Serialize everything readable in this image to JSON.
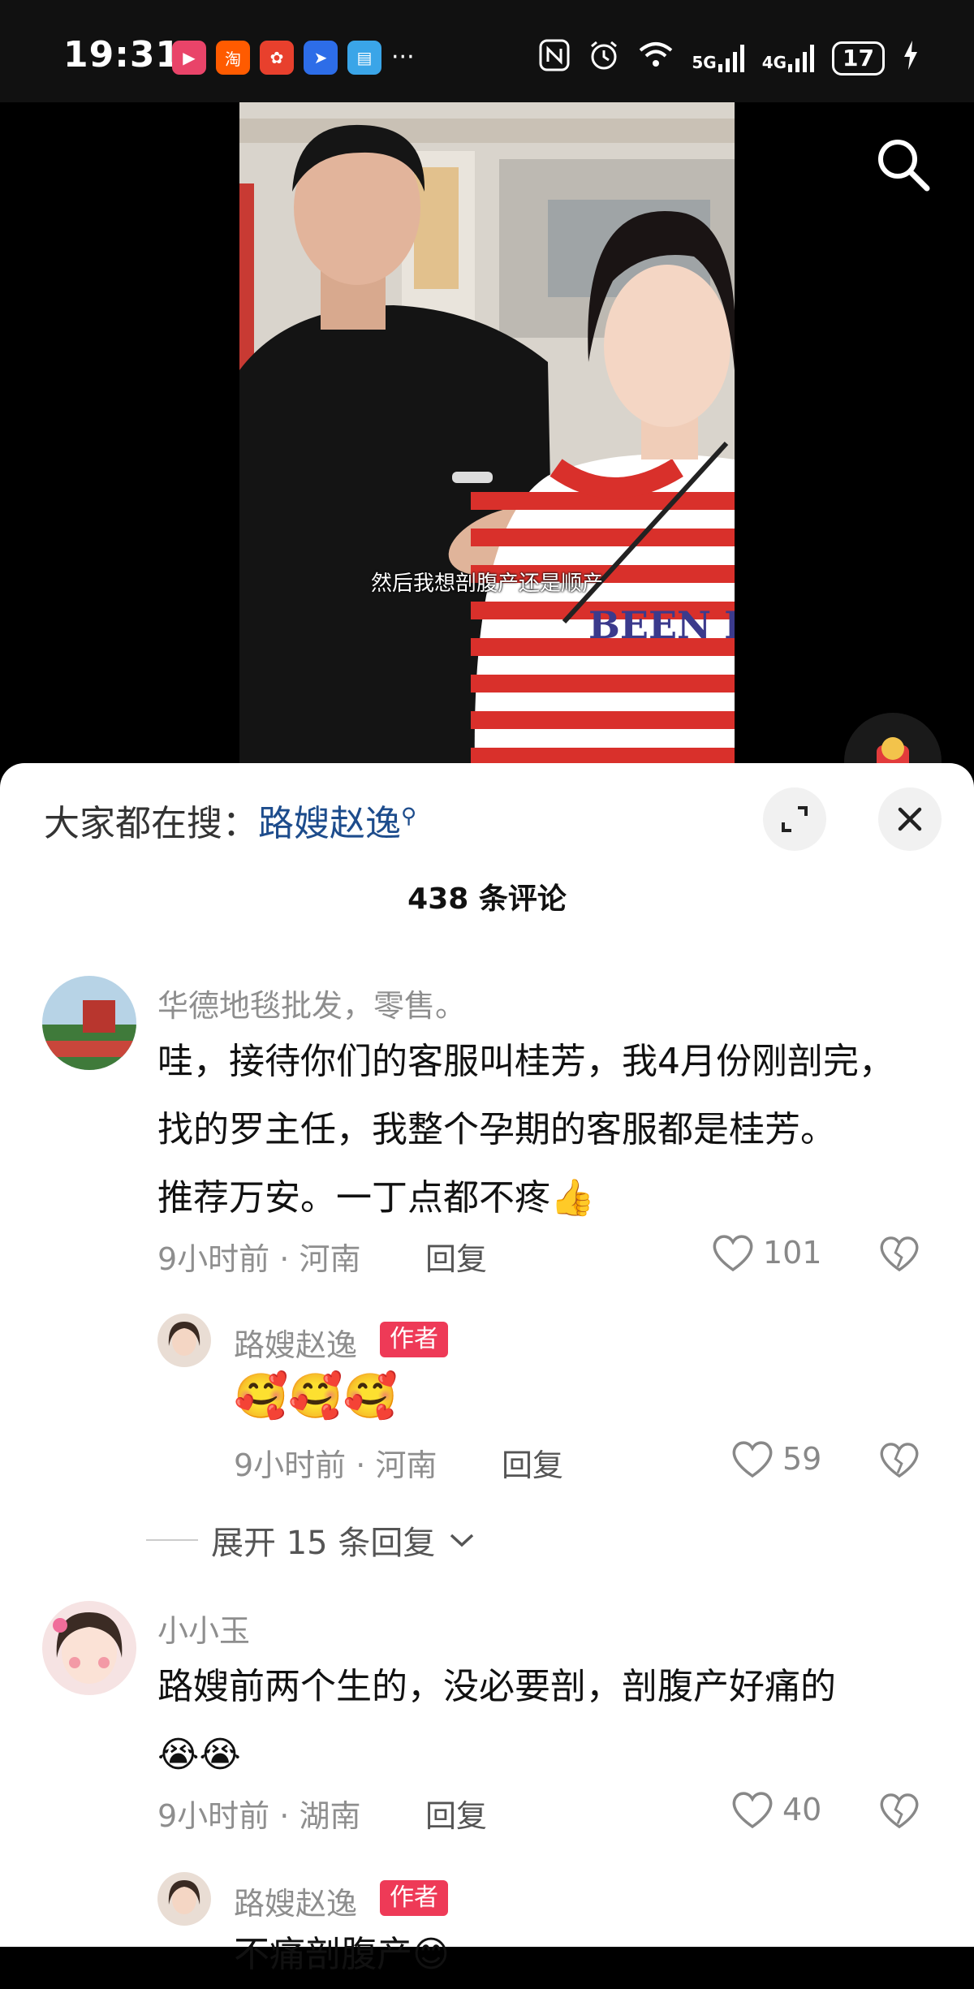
{
  "status_bar": {
    "time": "19:31",
    "more": "···",
    "network_5g": "5G",
    "network_4g": "4G",
    "battery": "17",
    "apps": [
      {
        "name": "video-app-icon",
        "color": "#e94469",
        "glyph": "▶"
      },
      {
        "name": "taobao-icon",
        "color": "#ff5b00",
        "glyph": "淘"
      },
      {
        "name": "game-app-icon",
        "color": "#e8402d",
        "glyph": "✿"
      },
      {
        "name": "feishu-icon",
        "color": "#2d6de8",
        "glyph": "➤"
      },
      {
        "name": "reader-icon",
        "color": "#3aa5e8",
        "glyph": "▤"
      }
    ]
  },
  "video": {
    "subtitle": "然后我想剖腹产还是顺产"
  },
  "sheet": {
    "hot_search_label": "大家都在搜：",
    "hot_search_keyword": "路嫂赵逸",
    "comment_count": "438 条评论"
  },
  "comments": [
    {
      "username": "华德地毯批发，零售。",
      "text_lines": [
        "哇，接待你们的客服叫桂芳，我4月份刚剖完，",
        "找的罗主任，我整个孕期的客服都是桂芳。",
        "推荐万安。一丁点都不疼👍"
      ],
      "time": "9小时前",
      "location": "河南",
      "reply_label": "回复",
      "likes": "101"
    },
    {
      "username": "路嫂赵逸",
      "badge": "作者",
      "emojis": "🥰🥰🥰",
      "time": "9小时前",
      "location": "河南",
      "reply_label": "回复",
      "likes": "59"
    },
    {
      "expand_label": "展开 15 条回复"
    },
    {
      "username": "小小玉",
      "text_lines": [
        "路嫂前两个生的，没必要剖，剖腹产好痛的",
        "😭😭"
      ],
      "time": "9小时前",
      "location": "湖南",
      "reply_label": "回复",
      "likes": "40"
    },
    {
      "username": "路嫂赵逸",
      "badge": "作者",
      "partial_text": "不痛剖腹产😊"
    }
  ]
}
